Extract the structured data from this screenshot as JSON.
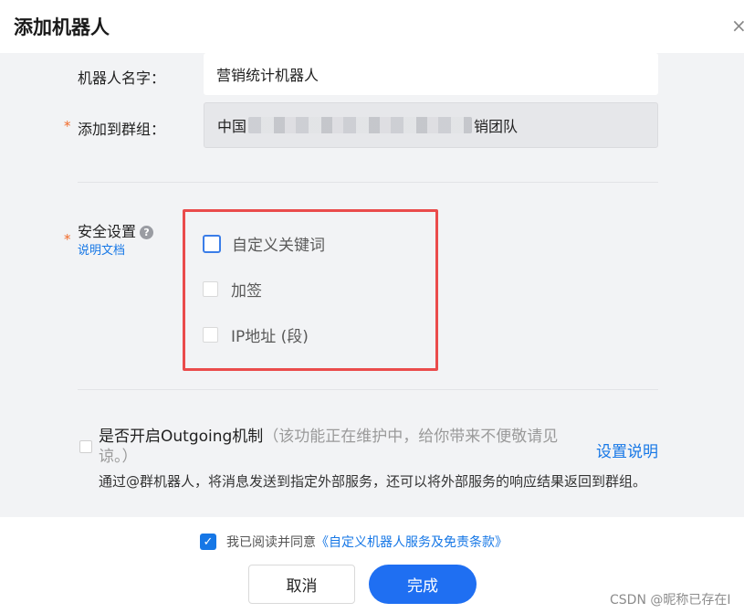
{
  "dialog": {
    "title": "添加机器人",
    "close_icon": "×"
  },
  "form": {
    "name_label": "机器人名字：",
    "name_value": "营销统计机器人",
    "group_label": "添加到群组：",
    "group_value_start": "中国",
    "group_value_end": "销团队",
    "required_mark": "*"
  },
  "security": {
    "label": "安全设置",
    "help_icon": "?",
    "doc_link": "说明文档",
    "options": [
      {
        "label": "自定义关键词",
        "checked": false
      },
      {
        "label": "加签",
        "checked": false
      },
      {
        "label": "IP地址 (段)",
        "checked": false
      }
    ],
    "highlight_color": "#ea4b4b"
  },
  "outgoing": {
    "title": "是否开启Outgoing机制",
    "note": "（该功能正在维护中，给你带来不便敬请见谅。）",
    "description": "通过@群机器人，将消息发送到指定外部服务，还可以将外部服务的响应结果返回到群组。",
    "settings_link": "设置说明",
    "checked": false
  },
  "agreement": {
    "checked": true,
    "check_icon": "✓",
    "text": "我已阅读并同意",
    "link": "《自定义机器人服务及免责条款》"
  },
  "buttons": {
    "cancel": "取消",
    "confirm": "完成"
  },
  "watermark": "CSDN @昵称已存在I",
  "colors": {
    "accent": "#1677e6",
    "primary_button": "#1f6ff2",
    "required": "#f26b2a"
  }
}
